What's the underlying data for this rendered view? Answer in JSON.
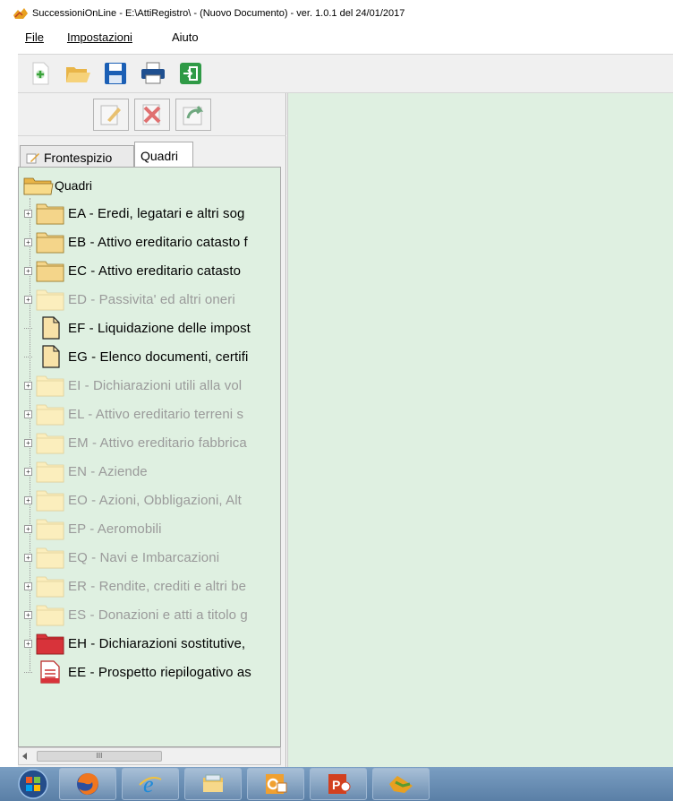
{
  "window": {
    "title": "SuccessioniOnLine - E:\\AttiRegistro\\ - (Nuovo Documento)  -  ver. 1.0.1 del 24/01/2017"
  },
  "menu": [
    {
      "label": "File"
    },
    {
      "label": "Impostazioni"
    },
    {
      "label": "Aiuto"
    }
  ],
  "toolbar": {
    "icons": [
      "new-icon",
      "open-icon",
      "save-icon",
      "print-icon",
      "exit-icon"
    ]
  },
  "edit_toolbar": {
    "icons": [
      "edit-icon",
      "delete-icon",
      "restore-icon"
    ]
  },
  "tabs": [
    {
      "label": "Frontespizio",
      "active": false
    },
    {
      "label": "Quadri",
      "active": true
    }
  ],
  "tree": {
    "root": "Quadri",
    "nodes": [
      {
        "label": "EA - Eredi, legatari e altri sog",
        "icon": "folder-icon",
        "enabled": true,
        "expandable": true
      },
      {
        "label": "EB - Attivo ereditario catasto f",
        "icon": "folder-icon",
        "enabled": true,
        "expandable": true
      },
      {
        "label": "EC - Attivo ereditario catasto",
        "icon": "folder-icon",
        "enabled": true,
        "expandable": true
      },
      {
        "label": "ED - Passivita' ed altri oneri",
        "icon": "folder-icon",
        "enabled": false,
        "expandable": true
      },
      {
        "label": "EF - Liquidazione delle impost",
        "icon": "document-icon",
        "enabled": true,
        "expandable": false
      },
      {
        "label": "EG - Elenco documenti, certifi",
        "icon": "document-icon",
        "enabled": true,
        "expandable": false
      },
      {
        "label": "EI - Dichiarazioni utili alla vol",
        "icon": "folder-icon",
        "enabled": false,
        "expandable": true
      },
      {
        "label": "EL - Attivo ereditario terreni s",
        "icon": "folder-icon",
        "enabled": false,
        "expandable": true
      },
      {
        "label": "EM - Attivo ereditario fabbrica",
        "icon": "folder-icon",
        "enabled": false,
        "expandable": true
      },
      {
        "label": "EN - Aziende",
        "icon": "folder-icon",
        "enabled": false,
        "expandable": true
      },
      {
        "label": "EO - Azioni, Obbligazioni, Alt",
        "icon": "folder-icon",
        "enabled": false,
        "expandable": true
      },
      {
        "label": "EP - Aeromobili",
        "icon": "folder-icon",
        "enabled": false,
        "expandable": true
      },
      {
        "label": "EQ - Navi e Imbarcazioni",
        "icon": "folder-icon",
        "enabled": false,
        "expandable": true
      },
      {
        "label": "ER - Rendite, crediti e altri be",
        "icon": "folder-icon",
        "enabled": false,
        "expandable": true
      },
      {
        "label": "ES - Donazioni e atti a titolo g",
        "icon": "folder-icon",
        "enabled": false,
        "expandable": true
      },
      {
        "label": "EH - Dichiarazioni sostitutive,",
        "icon": "red-folder-icon",
        "enabled": true,
        "expandable": true
      },
      {
        "label": "EE - Prospetto riepilogativo as",
        "icon": "summary-document-icon",
        "enabled": true,
        "expandable": false
      }
    ]
  },
  "scrollbar": {
    "grip": "III"
  },
  "colors": {
    "workspace_bg": "#dff0e1",
    "folder_yellow": "#f4d58a",
    "folder_yellow_disabled": "#fbeebd",
    "folder_red": "#d8333a",
    "disabled_text": "#9a9a9a"
  },
  "taskbar": {
    "items": [
      "start-orb",
      "firefox-icon",
      "internet-explorer-icon",
      "file-explorer-icon",
      "outlook-icon",
      "powerpoint-icon",
      "app-icon"
    ]
  }
}
